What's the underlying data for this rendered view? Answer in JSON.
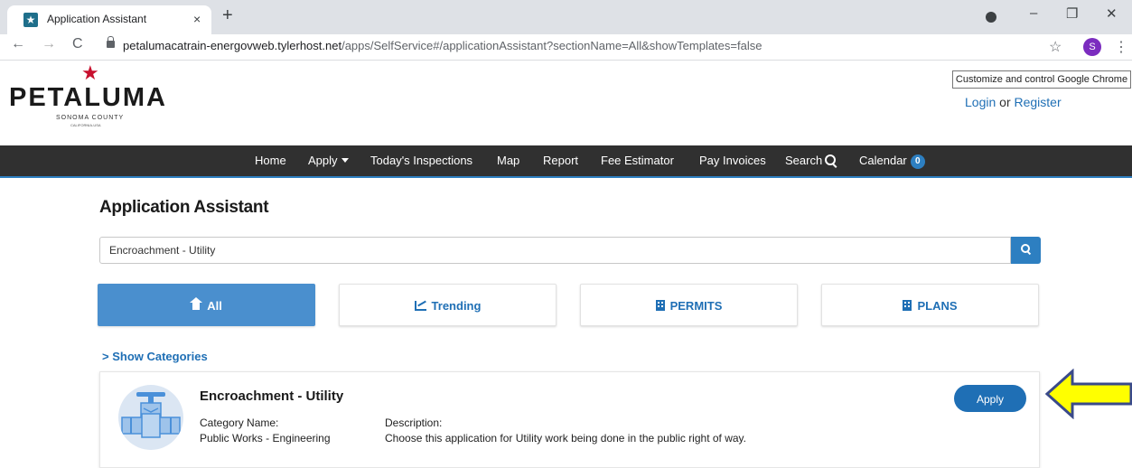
{
  "browser": {
    "tab_title": "Application Assistant",
    "tab_close": "×",
    "new_tab": "+",
    "url_host": "petalumacatrain-energovweb.tylerhost.net",
    "url_path": "/apps/SelfService#/applicationAssistant?sectionName=All&showTemplates=false",
    "profile_initial": "S",
    "tooltip": "Customize and control Google Chrome",
    "back": "←",
    "forward": "→",
    "reload": "C",
    "bookmark": "☆",
    "menu": "⋮",
    "minimize": "–",
    "restore": "❐",
    "close": "✕"
  },
  "site": {
    "logo_word": "PETALUMA",
    "logo_sub": "SONOMA COUNTY",
    "logo_sub2": "CALIFORNIA-USA",
    "login": "Login",
    "or": " or ",
    "register": "Register"
  },
  "nav": {
    "home": "Home",
    "apply": "Apply",
    "inspections": "Today's Inspections",
    "map": "Map",
    "report": "Report",
    "fee_estimator": "Fee Estimator",
    "pay_invoices": "Pay Invoices",
    "search": "Search",
    "calendar": "Calendar",
    "calendar_count": "0"
  },
  "content": {
    "page_title": "Application Assistant",
    "search_value": "Encroachment - Utility",
    "filters": {
      "all": "All",
      "trending": "Trending",
      "permits": "PERMITS",
      "plans": "PLANS"
    },
    "show_categories": "> Show Categories",
    "result": {
      "title": "Encroachment - Utility",
      "category_label": "Category Name:",
      "category_value": "Public Works - Engineering",
      "description_label": "Description:",
      "description_value": "Choose this application for Utility work being done in the public right of way.",
      "apply_label": "Apply"
    }
  },
  "colors": {
    "accent": "#2d7fc1",
    "link": "#1f6fb5",
    "nav_bg": "#303030",
    "arrow_fill": "#ffff00",
    "arrow_stroke": "#3a4a8a",
    "logo_star": "#c8102e"
  }
}
